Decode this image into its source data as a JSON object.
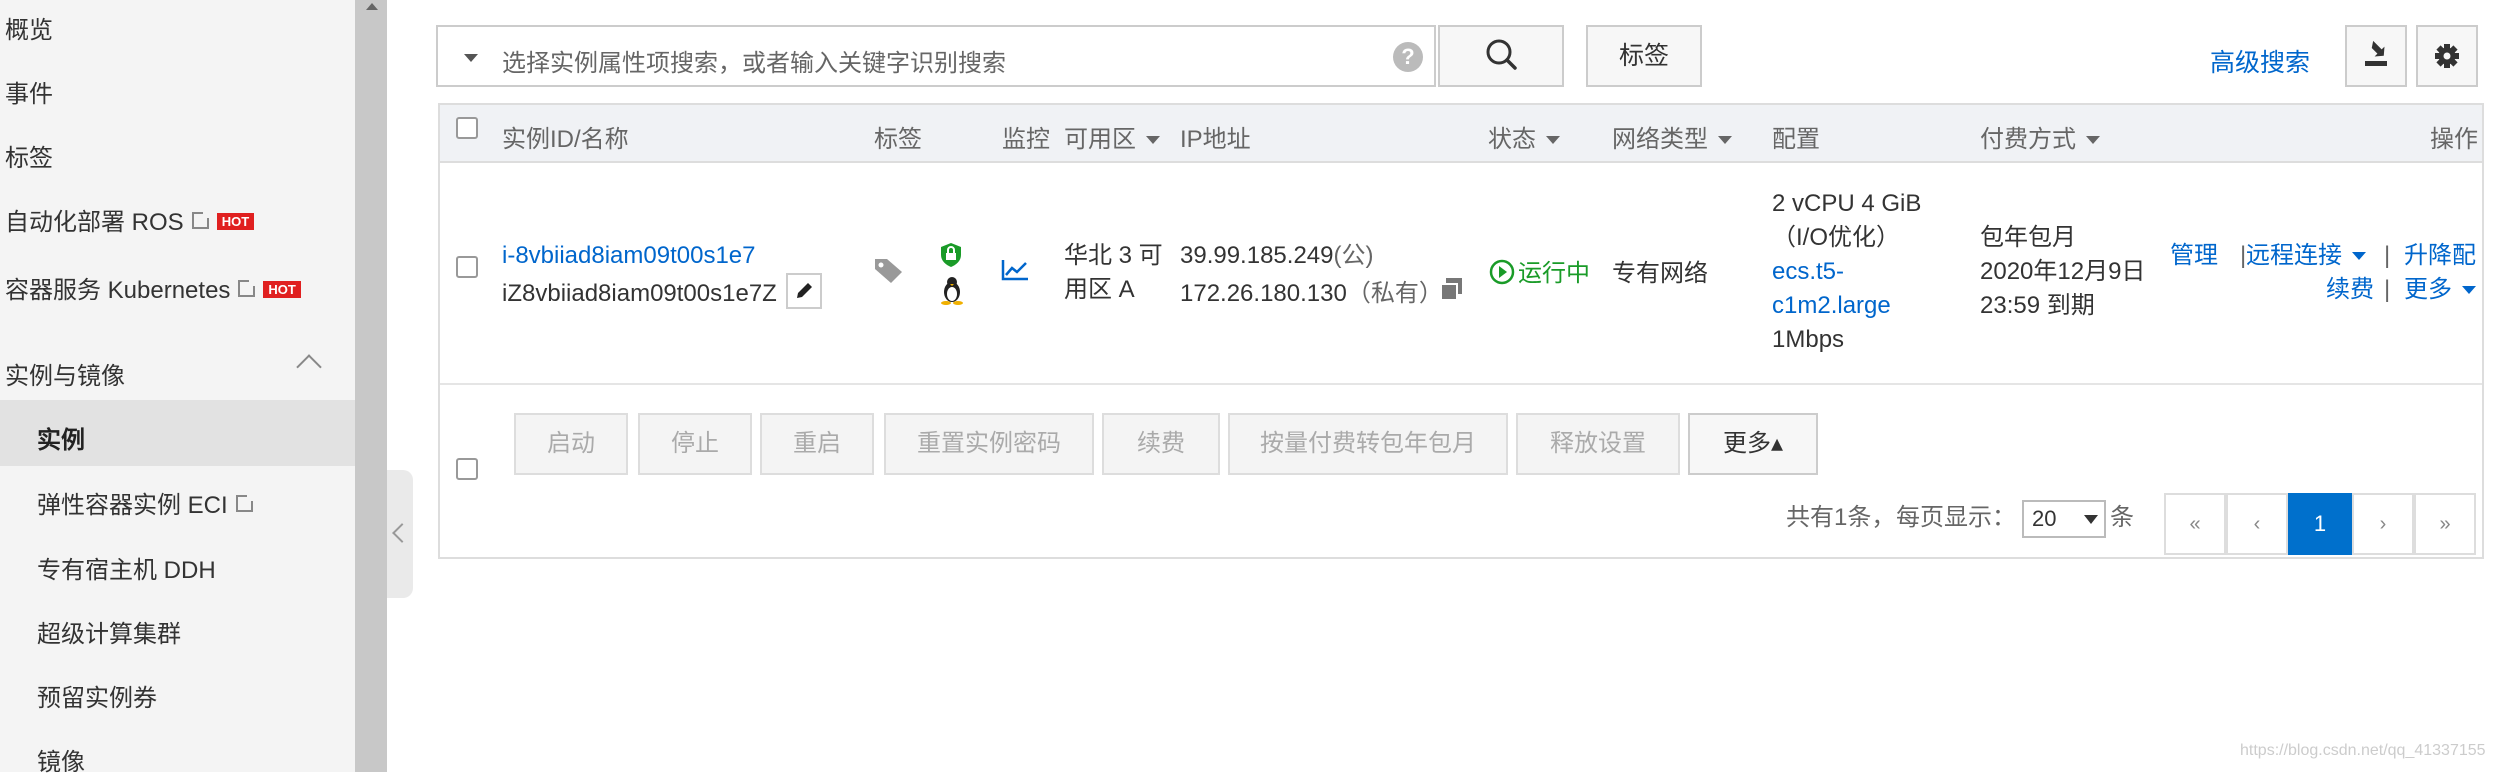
{
  "sidebar": {
    "items": [
      {
        "label": "概览"
      },
      {
        "label": "事件"
      },
      {
        "label": "标签"
      },
      {
        "label": "自动化部署 ROS",
        "badge": "HOT"
      },
      {
        "label": "容器服务 Kubernetes",
        "badge": "HOT"
      }
    ],
    "section": {
      "label": "实例与镜像"
    },
    "sub_items": [
      {
        "label": "实例"
      },
      {
        "label": "弹性容器实例 ECI"
      },
      {
        "label": "专有宿主机 DDH"
      },
      {
        "label": "超级计算集群"
      },
      {
        "label": "预留实例券"
      },
      {
        "label": "镜像"
      }
    ]
  },
  "toolbar": {
    "search_placeholder": "选择实例属性项搜索，或者输入关键字识别搜索",
    "help": "?",
    "tag_label": "标签",
    "advanced_search": "高级搜索"
  },
  "table": {
    "headers": {
      "id_name": "实例ID/名称",
      "tags": "标签",
      "monitor": "监控",
      "zone": "可用区",
      "ip": "IP地址",
      "status": "状态",
      "network": "网络类型",
      "config": "配置",
      "billing": "付费方式",
      "ops": "操作"
    },
    "row": {
      "instance_id": "i-8vbiiad8iam09t00s1e7",
      "instance_name": "iZ8vbiiad8iam09t00s1e7Z",
      "zone_line1": "华北 3 可",
      "zone_line2": "用区 A",
      "public_ip": "39.99.185.249",
      "public_suffix": "(公)",
      "private_ip": "172.26.180.130",
      "private_suffix": "（私有）",
      "status": "运行中",
      "network": "专有网络",
      "config_line1": "2 vCPU 4 GiB",
      "config_line2": "（I/O优化）",
      "config_spec1": "ecs.t5-",
      "config_spec2": "c1m2.large",
      "config_bw": "1Mbps",
      "billing_type": "包年包月",
      "billing_date": "2020年12月9日",
      "billing_expire": "23:59 到期",
      "op_manage": "管理",
      "op_remote": "远程连接",
      "op_upgrade": "升降配",
      "op_renew": "续费",
      "op_more": "更多",
      "sep": "|"
    }
  },
  "actions": {
    "start": "启动",
    "stop": "停止",
    "restart": "重启",
    "reset_pwd": "重置实例密码",
    "renew": "续费",
    "convert": "按量付费转包年包月",
    "release": "释放设置",
    "more": "更多▴"
  },
  "pagination": {
    "total_text": "共有1条，",
    "per_page_text": "每页显示：",
    "page_size": "20",
    "unit": "条",
    "first": "«",
    "prev": "‹",
    "current": "1",
    "next": "›",
    "last": "»"
  },
  "watermark": "https://blog.csdn.net/qq_41337155"
}
